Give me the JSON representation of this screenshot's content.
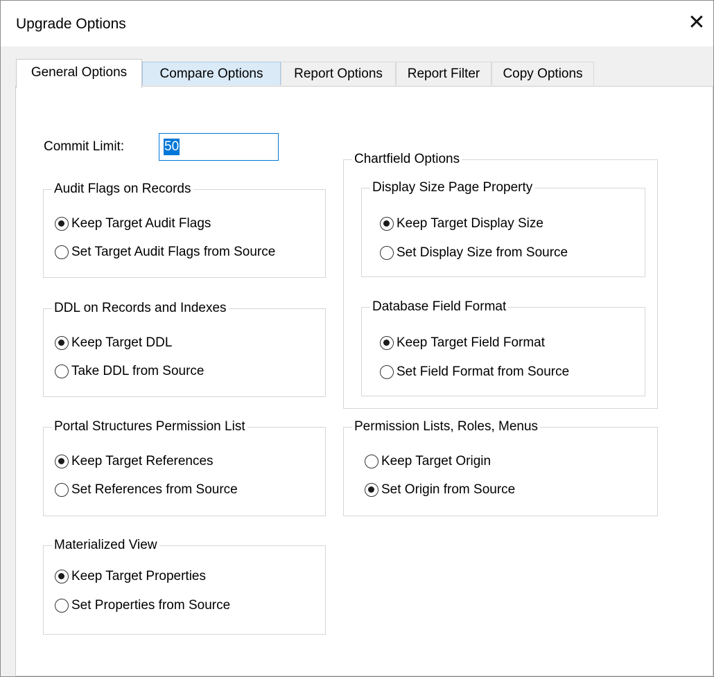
{
  "window": {
    "title": "Upgrade Options",
    "close_icon": "close-icon"
  },
  "tabs": [
    {
      "label": "General Options",
      "state": "active"
    },
    {
      "label": "Compare Options",
      "state": "hover"
    },
    {
      "label": "Report Options",
      "state": "normal"
    },
    {
      "label": "Report Filter",
      "state": "normal"
    },
    {
      "label": "Copy Options",
      "state": "normal"
    }
  ],
  "commit_limit": {
    "label": "Commit Limit:",
    "value": "50"
  },
  "groups": {
    "audit_flags": {
      "title": "Audit Flags on Records",
      "options": [
        "Keep Target Audit Flags",
        "Set Target Audit Flags from Source"
      ],
      "selected": 0
    },
    "ddl": {
      "title": "DDL on Records and Indexes",
      "options": [
        "Keep Target DDL",
        "Take DDL from Source"
      ],
      "selected": 0
    },
    "portal": {
      "title": "Portal Structures Permission List",
      "options": [
        "Keep Target References",
        "Set References from Source"
      ],
      "selected": 0
    },
    "materialized": {
      "title": "Materialized View",
      "options": [
        "Keep Target Properties",
        "Set Properties from Source"
      ],
      "selected": 0
    },
    "chartfield": {
      "title": "Chartfield Options",
      "display_size": {
        "title": "Display Size Page Property",
        "options": [
          "Keep Target Display Size",
          "Set Display Size from Source"
        ],
        "selected": 0
      },
      "field_format": {
        "title": "Database Field Format",
        "options": [
          "Keep Target Field Format",
          "Set Field Format from Source"
        ],
        "selected": 0
      }
    },
    "permission": {
      "title": "Permission Lists, Roles, Menus",
      "options": [
        "Keep Target Origin",
        "Set Origin from Source"
      ],
      "selected": 1
    }
  }
}
